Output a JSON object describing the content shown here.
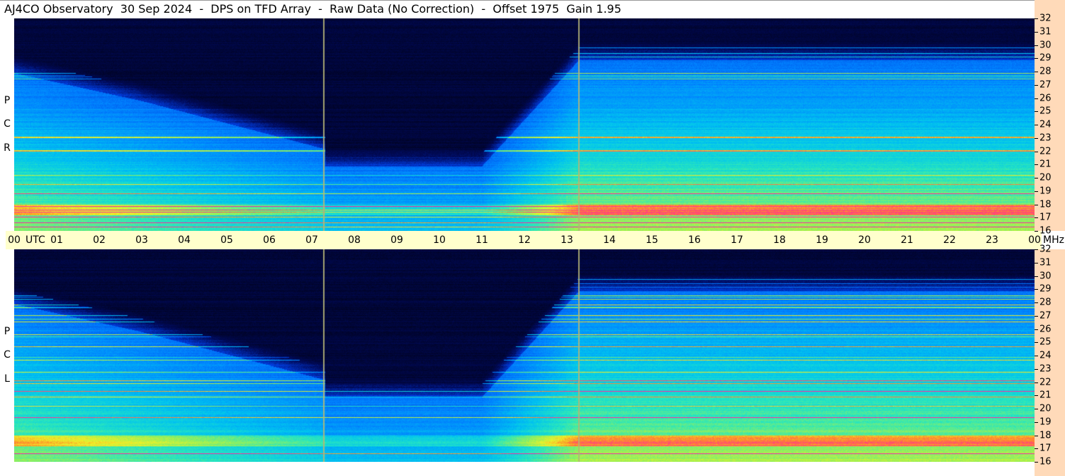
{
  "title": "AJ4CO Observatory  30 Sep 2024  -  DPS on TFD Array  -  Raw Data (No Correction)  -  Offset 1975  Gain 1.95",
  "panels": [
    {
      "name": "R C P",
      "letters": [
        "R",
        "C",
        "P"
      ]
    },
    {
      "name": "L C P",
      "letters": [
        "L",
        "C",
        "P"
      ]
    }
  ],
  "colors": {
    "time_axis_bg": "#ffffcc",
    "freq_axis_bg": "#ffdab9",
    "background": "#000000"
  },
  "chart_data": [
    {
      "type": "heatmap",
      "title": "AJ4CO Observatory  30 Sep 2024  -  DPS on TFD Array  -  Raw Data (No Correction)  -  Offset 1975  Gain 1.95",
      "panel": "RCP",
      "x_label": "UTC",
      "y_label": "MHz",
      "x_ticks": [
        "00",
        "01",
        "02",
        "03",
        "04",
        "05",
        "06",
        "07",
        "08",
        "09",
        "10",
        "11",
        "12",
        "13",
        "14",
        "15",
        "16",
        "17",
        "18",
        "19",
        "20",
        "21",
        "22",
        "23",
        "00"
      ],
      "y_ticks": [
        16,
        17,
        18,
        19,
        20,
        21,
        22,
        23,
        24,
        25,
        26,
        27,
        28,
        29,
        30,
        31,
        32
      ],
      "xlim": [
        0,
        24
      ],
      "ylim": [
        16,
        32
      ]
    },
    {
      "type": "heatmap",
      "panel": "LCP",
      "x_label": "UTC",
      "y_label": "MHz",
      "x_ticks": [
        "00",
        "01",
        "02",
        "03",
        "04",
        "05",
        "06",
        "07",
        "08",
        "09",
        "10",
        "11",
        "12",
        "13",
        "14",
        "15",
        "16",
        "17",
        "18",
        "19",
        "20",
        "21",
        "22",
        "23",
        "00"
      ],
      "y_ticks": [
        16,
        17,
        18,
        19,
        20,
        21,
        22,
        23,
        24,
        25,
        26,
        27,
        28,
        29,
        30,
        31,
        32
      ],
      "xlim": [
        0,
        24
      ],
      "ylim": [
        16,
        32
      ]
    }
  ],
  "time_axis": {
    "ticks": [
      "00",
      "01",
      "02",
      "03",
      "04",
      "05",
      "06",
      "07",
      "08",
      "09",
      "10",
      "11",
      "12",
      "13",
      "14",
      "15",
      "16",
      "17",
      "18",
      "19",
      "20",
      "21",
      "22",
      "23",
      "00"
    ],
    "utc_label": "UTC",
    "mhz_label": "MHz"
  },
  "freq_axis": {
    "ticks": [
      "32",
      "31",
      "30",
      "29",
      "28",
      "27",
      "26",
      "25",
      "24",
      "23",
      "22",
      "21",
      "20",
      "19",
      "18",
      "17",
      "16"
    ]
  }
}
